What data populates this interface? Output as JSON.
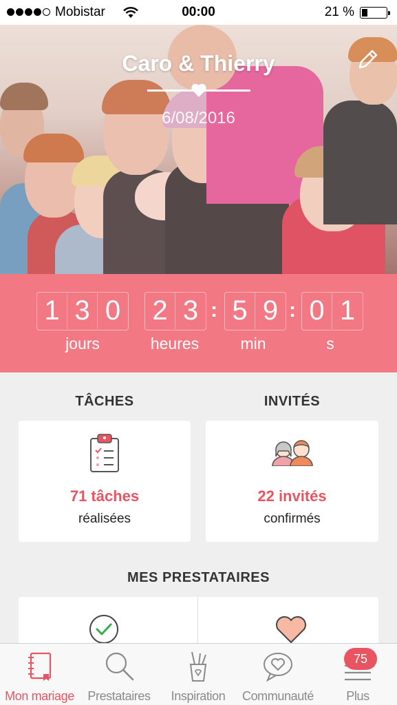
{
  "status_bar": {
    "carrier": "Mobistar",
    "time": "00:00",
    "battery": "21 %",
    "battery_level": 0.21
  },
  "hero": {
    "couple_names": "Caro & Thierry",
    "wedding_date": "6/08/2016"
  },
  "countdown": {
    "days_digits": [
      "1",
      "3",
      "0"
    ],
    "hours_digits": [
      "2",
      "3"
    ],
    "minutes_digits": [
      "5",
      "9"
    ],
    "seconds_digits": [
      "0",
      "1"
    ],
    "days_label": "jours",
    "hours_label": "heures",
    "minutes_label": "min",
    "seconds_label": "s",
    "separator": ":"
  },
  "tasks": {
    "title": "TÂCHES",
    "count": "71 tâches",
    "status": "réalisées"
  },
  "guests": {
    "title": "INVITÉS",
    "count": "22 invités",
    "status": "confirmés"
  },
  "vendors": {
    "title": "MES PRESTATAIRES"
  },
  "tabbar": {
    "items": [
      {
        "label": "Mon mariage",
        "icon": "notebook-icon",
        "active": true
      },
      {
        "label": "Prestataires",
        "icon": "search-icon",
        "active": false
      },
      {
        "label": "Inspiration",
        "icon": "pencil-cup-icon",
        "active": false
      },
      {
        "label": "Communauté",
        "icon": "chat-heart-icon",
        "active": false
      },
      {
        "label": "Plus",
        "icon": "menu-icon",
        "active": false
      }
    ],
    "badge": "75"
  },
  "colors": {
    "accent": "#f27883",
    "accent_text": "#e8545f",
    "background": "#efefef"
  }
}
